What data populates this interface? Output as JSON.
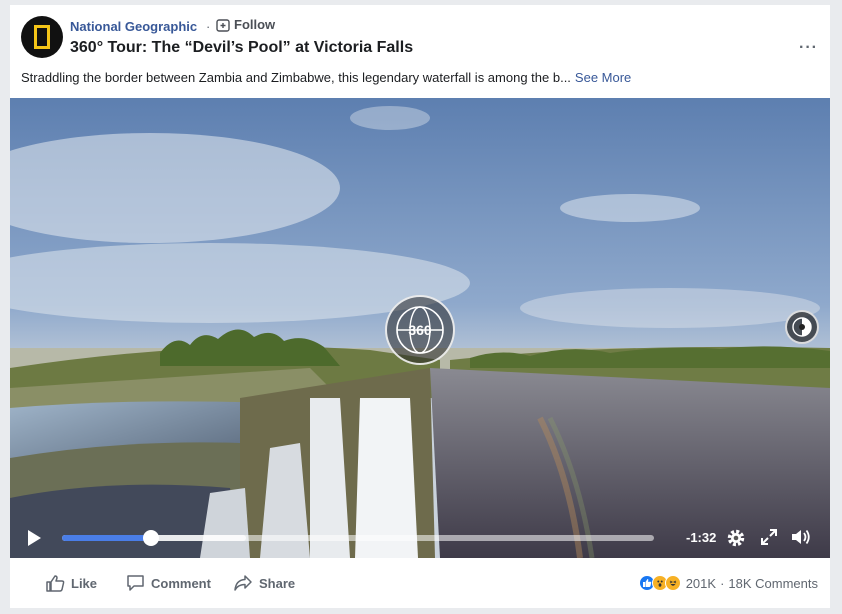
{
  "post": {
    "page_name": "National Geographic",
    "separator": "·",
    "follow_label": "Follow",
    "title": "360° Tour: The “Devil’s Pool” at Victoria Falls",
    "description": "Straddling the border between Zambia and Zimbabwe, this legendary waterfall is among the b...",
    "see_more_label": "See More",
    "more_options": "···"
  },
  "video": {
    "badge_label": "360",
    "time_remaining": "-1:32",
    "progress": 0.15,
    "buffered": 0.31
  },
  "actions": {
    "like_label": "Like",
    "comment_label": "Comment",
    "share_label": "Share"
  },
  "stats": {
    "reaction_count": "201K",
    "separator": "·",
    "comment_count": "18K Comments"
  },
  "icons": [
    "plus-square-icon",
    "ellipsis-icon",
    "globe-icon",
    "compass-icon",
    "play-icon",
    "gear-icon",
    "fullscreen-icon",
    "volume-icon",
    "thumbs-up-icon",
    "comment-icon",
    "share-arrow-icon",
    "like-reaction-icon",
    "wow-reaction-icon",
    "haha-reaction-icon"
  ],
  "colors": {
    "link_blue": "#385898",
    "progress_blue": "#4a7ee8",
    "reaction_blue": "#1877f2",
    "reaction_yellow": "#f7b125"
  }
}
